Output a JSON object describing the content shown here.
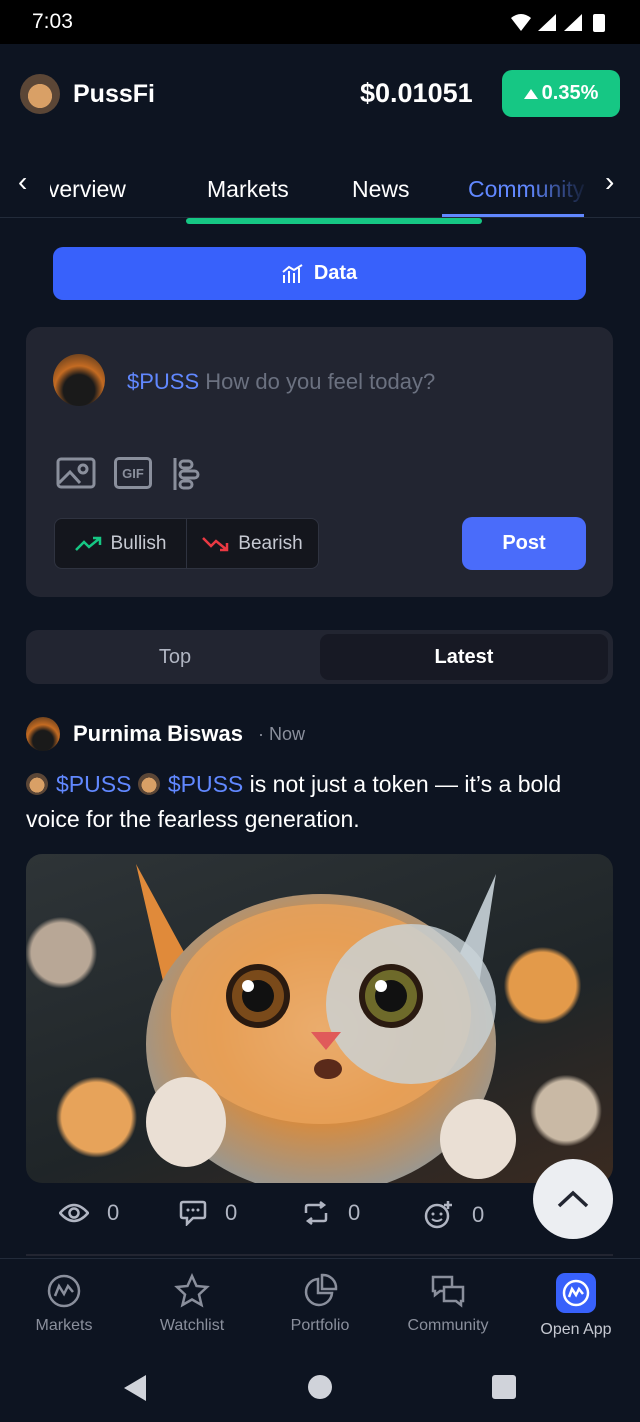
{
  "status_bar": {
    "time": "7:03"
  },
  "header": {
    "coin_name": "PussFi",
    "price": "$0.01051",
    "change": "0.35%",
    "change_color": "#16c784"
  },
  "tabs": [
    {
      "label": "Overview"
    },
    {
      "label": "Markets"
    },
    {
      "label": "News"
    },
    {
      "label": "Community",
      "active": true
    }
  ],
  "data_button": {
    "label": "Data"
  },
  "composer": {
    "tag": "$PUSS",
    "placeholder": "How do you feel today?",
    "gif_label": "GIF",
    "bullish_label": "Bullish",
    "bearish_label": "Bearish",
    "post_label": "Post"
  },
  "feed_toggle": {
    "top_label": "Top",
    "latest_label": "Latest",
    "selected": "Latest"
  },
  "post": {
    "author": "Purnima Biswas",
    "time": "· Now",
    "tag1": "$PUSS",
    "tag2": "$PUSS",
    "text": " is not just a token — it’s a bold voice for the fearless generation.",
    "views": "0",
    "comments": "0",
    "reposts": "0",
    "reactions": "0"
  },
  "bottom_nav": [
    {
      "label": "Markets",
      "icon": "markets-icon"
    },
    {
      "label": "Watchlist",
      "icon": "star-icon"
    },
    {
      "label": "Portfolio",
      "icon": "pie-chart-icon"
    },
    {
      "label": "Community",
      "icon": "chat-bubbles-icon"
    },
    {
      "label": "Open App",
      "icon": "app-logo-icon"
    }
  ],
  "colors": {
    "accent": "#3861fb",
    "positive": "#16c784",
    "negative": "#ea3943",
    "background": "#0d1421"
  }
}
